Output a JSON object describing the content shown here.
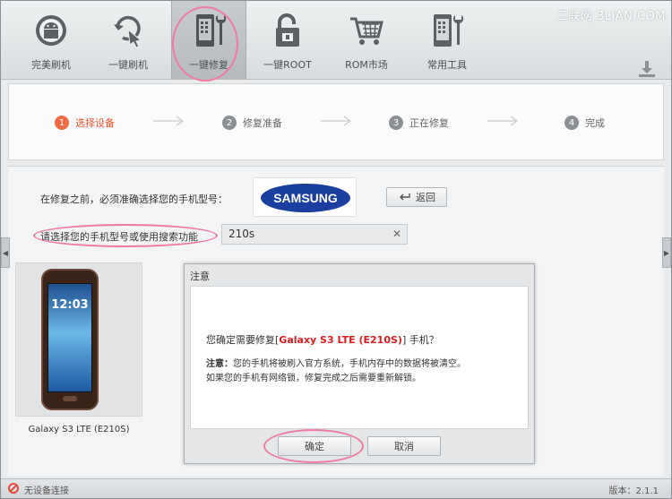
{
  "toolbar": {
    "items": [
      {
        "label": "完美刷机",
        "icon": "android-robot-icon"
      },
      {
        "label": "一键刷机",
        "icon": "refresh-touch-icon"
      },
      {
        "label": "一键修复",
        "icon": "phone-wrench-icon"
      },
      {
        "label": "一键ROOT",
        "icon": "unlock-icon"
      },
      {
        "label": "ROM市场",
        "icon": "shopping-cart-icon"
      },
      {
        "label": "常用工具",
        "icon": "phone-tools-icon"
      }
    ],
    "active_index": 2,
    "download_icon": "download-icon"
  },
  "watermark": "三联网 3LIAN.COM",
  "steps": [
    {
      "num": "1",
      "label": "选择设备"
    },
    {
      "num": "2",
      "label": "修复准备"
    },
    {
      "num": "3",
      "label": "正在修复"
    },
    {
      "num": "4",
      "label": "完成"
    }
  ],
  "select": {
    "prompt": "在修复之前，必须准确选择您的手机型号：",
    "brand": "SAMSUNG",
    "back_label": "返回",
    "search_label": "请选择您的手机型号或使用搜索功能",
    "search_value": "210s"
  },
  "device": {
    "name": "Galaxy S3 LTE (E210S)",
    "screen_time": "12:03"
  },
  "dialog": {
    "title": "注意",
    "question_prefix": "您确定需要修复[",
    "question_model": "Galaxy S3 LTE (E210S)",
    "question_suffix": "] 手机？",
    "note_label": "注意：",
    "note_line1": "您的手机将被刷入官方系统，手机内存中的数据将被清空。",
    "note_line2": "如果您的手机有网络锁，修复完成之后需要重新解锁。",
    "ok_label": "确定",
    "cancel_label": "取消"
  },
  "status": {
    "text": "无设备连接",
    "version": "版本：2.1.1"
  },
  "colors": {
    "accent_step": "#f06a44",
    "highlight_circle": "#f07aa3",
    "model_red": "#d81e1e",
    "samsung_blue": "#1b3f9e"
  }
}
